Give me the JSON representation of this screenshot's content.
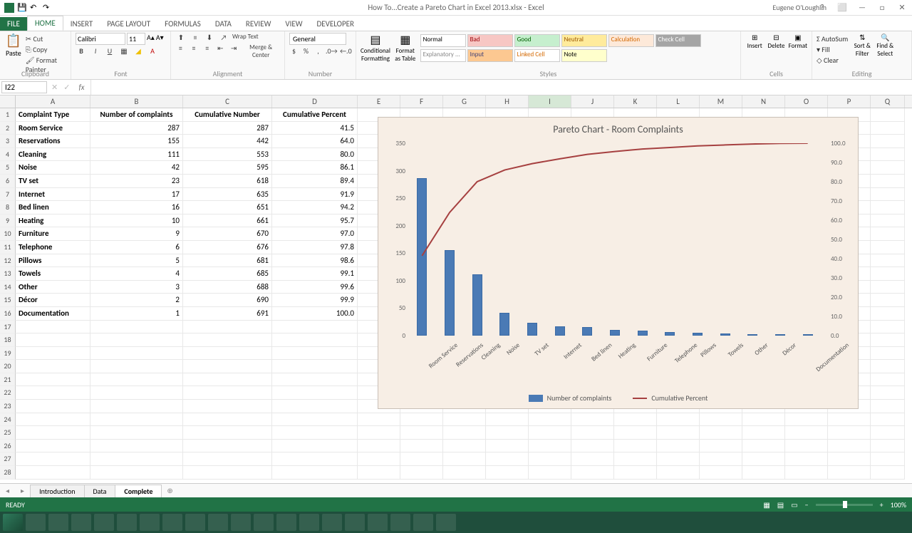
{
  "title": "How To...Create a Pareto Chart in Excel 2013.xlsx - Excel",
  "user": "Eugene O'Loughlin",
  "tabs": [
    "FILE",
    "HOME",
    "INSERT",
    "PAGE LAYOUT",
    "FORMULAS",
    "DATA",
    "REVIEW",
    "VIEW",
    "DEVELOPER"
  ],
  "clipboard": {
    "paste": "Paste",
    "cut": "Cut",
    "copy": "Copy",
    "fp": "Format Painter",
    "label": "Clipboard"
  },
  "font": {
    "name": "Calibri",
    "size": "11",
    "label": "Font"
  },
  "alignment": {
    "wrap": "Wrap Text",
    "merge": "Merge & Center",
    "label": "Alignment"
  },
  "number": {
    "format": "General",
    "label": "Number"
  },
  "styles": {
    "cf": "Conditional Formatting",
    "fat": "Format as Table",
    "cells": [
      {
        "t": "Normal",
        "bg": "#fff",
        "c": "#000"
      },
      {
        "t": "Bad",
        "bg": "#f7c7c4",
        "c": "#9c0006"
      },
      {
        "t": "Good",
        "bg": "#c6efce",
        "c": "#006100"
      },
      {
        "t": "Neutral",
        "bg": "#ffeb9c",
        "c": "#9c5700"
      },
      {
        "t": "Calculation",
        "bg": "#fde9d9",
        "c": "#d46800"
      },
      {
        "t": "Check Cell",
        "bg": "#a5a5a5",
        "c": "#fff"
      },
      {
        "t": "Explanatory ...",
        "bg": "#fff",
        "c": "#888"
      },
      {
        "t": "Input",
        "bg": "#fcc891",
        "c": "#3f3f76"
      },
      {
        "t": "Linked Cell",
        "bg": "#fff",
        "c": "#d46800"
      },
      {
        "t": "Note",
        "bg": "#ffffcc",
        "c": "#000"
      }
    ],
    "label": "Styles"
  },
  "cells_group": {
    "insert": "Insert",
    "delete": "Delete",
    "format": "Format",
    "label": "Cells"
  },
  "editing": {
    "autosum": "AutoSum",
    "fill": "Fill",
    "clear": "Clear",
    "sort": "Sort & Filter",
    "find": "Find & Select",
    "label": "Editing"
  },
  "namebox": "I22",
  "columns": [
    {
      "l": "A",
      "w": 105
    },
    {
      "l": "B",
      "w": 130
    },
    {
      "l": "C",
      "w": 125
    },
    {
      "l": "D",
      "w": 120
    },
    {
      "l": "E",
      "w": 60
    },
    {
      "l": "F",
      "w": 60
    },
    {
      "l": "G",
      "w": 60
    },
    {
      "l": "H",
      "w": 60
    },
    {
      "l": "I",
      "w": 60
    },
    {
      "l": "J",
      "w": 60
    },
    {
      "l": "K",
      "w": 60
    },
    {
      "l": "L",
      "w": 60
    },
    {
      "l": "M",
      "w": 60
    },
    {
      "l": "N",
      "w": 60
    },
    {
      "l": "O",
      "w": 60
    },
    {
      "l": "P",
      "w": 60
    },
    {
      "l": "Q",
      "w": 48
    }
  ],
  "headers": [
    "Complaint Type",
    "Number of complaints",
    "Cumulative Number",
    "Cumulative Percent"
  ],
  "data_rows": [
    [
      "Room Service",
      287,
      287,
      "41.5"
    ],
    [
      "Reservations",
      155,
      442,
      "64.0"
    ],
    [
      "Cleaning",
      111,
      553,
      "80.0"
    ],
    [
      "Noise",
      42,
      595,
      "86.1"
    ],
    [
      "TV set",
      23,
      618,
      "89.4"
    ],
    [
      "Internet",
      17,
      635,
      "91.9"
    ],
    [
      "Bed linen",
      16,
      651,
      "94.2"
    ],
    [
      "Heating",
      10,
      661,
      "95.7"
    ],
    [
      "Furniture",
      9,
      670,
      "97.0"
    ],
    [
      "Telephone",
      6,
      676,
      "97.8"
    ],
    [
      "Pillows",
      5,
      681,
      "98.6"
    ],
    [
      "Towels",
      4,
      685,
      "99.1"
    ],
    [
      "Other",
      3,
      688,
      "99.6"
    ],
    [
      "Décor",
      2,
      690,
      "99.9"
    ],
    [
      "Documentation",
      1,
      691,
      "100.0"
    ]
  ],
  "chart_data": {
    "type": "pareto",
    "title": "Pareto Chart - Room Complaints",
    "categories": [
      "Room Service",
      "Reservations",
      "Cleaning",
      "Noise",
      "TV set",
      "Internet",
      "Bed linen",
      "Heating",
      "Furniture",
      "Telephone",
      "Pillows",
      "Towels",
      "Other",
      "Décor",
      "Documentation"
    ],
    "series": [
      {
        "name": "Number of complaints",
        "type": "bar",
        "axis": "left",
        "values": [
          287,
          155,
          111,
          42,
          23,
          17,
          16,
          10,
          9,
          6,
          5,
          4,
          3,
          2,
          1
        ]
      },
      {
        "name": "Cumulative Percent",
        "type": "line",
        "axis": "right",
        "values": [
          41.5,
          64.0,
          80.0,
          86.1,
          89.4,
          91.9,
          94.2,
          95.7,
          97.0,
          97.8,
          98.6,
          99.1,
          99.6,
          99.9,
          100.0
        ]
      }
    ],
    "ylim_left": [
      0,
      350
    ],
    "yticks_left": [
      0,
      50,
      100,
      150,
      200,
      250,
      300,
      350
    ],
    "ylim_right": [
      0,
      100
    ],
    "yticks_right": [
      "0.0",
      "10.0",
      "20.0",
      "30.0",
      "40.0",
      "50.0",
      "60.0",
      "70.0",
      "80.0",
      "90.0",
      "100.0"
    ],
    "legend": [
      "Number of complaints",
      "Cumulative Percent"
    ]
  },
  "sheet_tabs": [
    "Introduction",
    "Data",
    "Complete"
  ],
  "active_sheet": "Complete",
  "status": {
    "ready": "READY",
    "zoom": "100%"
  }
}
